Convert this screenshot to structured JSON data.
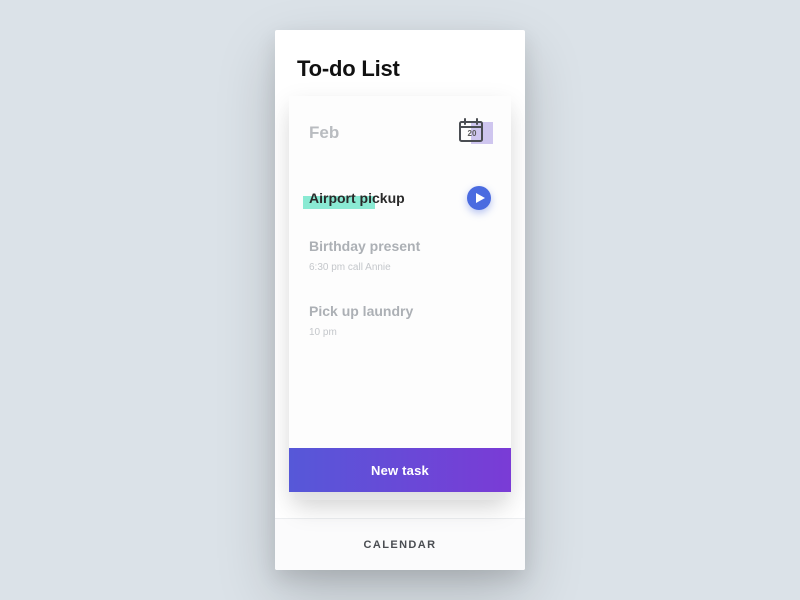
{
  "header": {
    "title": "To-do List"
  },
  "card": {
    "month": "Feb",
    "calendar_day": "20"
  },
  "tasks": [
    {
      "title": "Airport pickup",
      "sub": "",
      "active": true
    },
    {
      "title": "Birthday present",
      "sub": "6:30 pm call Annie",
      "active": false
    },
    {
      "title": "Pick up laundry",
      "sub": "10 pm",
      "active": false
    }
  ],
  "actions": {
    "new_task": "New task"
  },
  "bottom": {
    "calendar": "CALENDAR"
  },
  "colors": {
    "accent_teal": "#63e3c4",
    "accent_blue": "#4a6be0",
    "gradient_start": "#5658d8",
    "gradient_end": "#7a3bd6"
  }
}
